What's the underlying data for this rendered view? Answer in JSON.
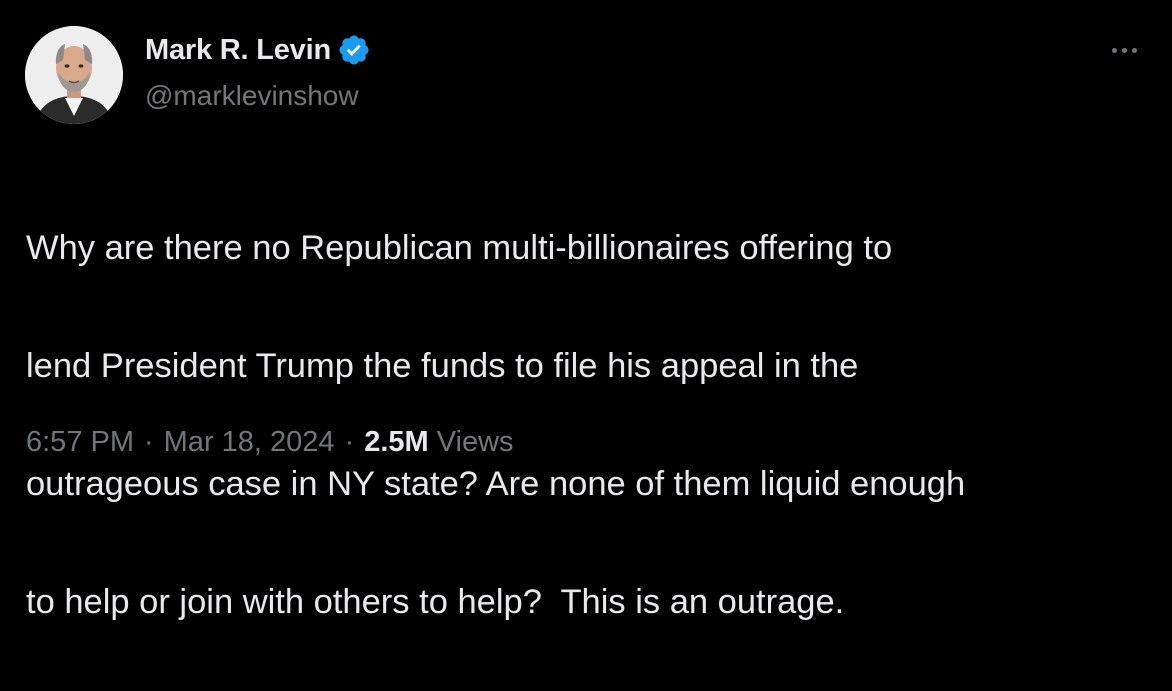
{
  "author": {
    "display_name": "Mark R. Levin",
    "handle": "@marklevinshow",
    "verified": true,
    "verified_color": "#1d9bf0"
  },
  "tweet": {
    "lines": [
      "Why are there no Republican multi-billionaires offering to",
      "lend President Trump the funds to file his appeal in the",
      "outrageous case in NY state? Are none of them liquid enough",
      "to help or join with others to help?  This is an outrage."
    ]
  },
  "meta": {
    "time": "6:57 PM",
    "separator": "·",
    "date": "Mar 18, 2024",
    "views_count": "2.5M",
    "views_label": "Views"
  },
  "icons": {
    "verified": "verified-badge-icon",
    "more": "more-options-icon"
  },
  "colors": {
    "background": "#000000",
    "primary_text": "#e7e9ea",
    "secondary_text": "#71767b",
    "accent": "#1d9bf0"
  }
}
